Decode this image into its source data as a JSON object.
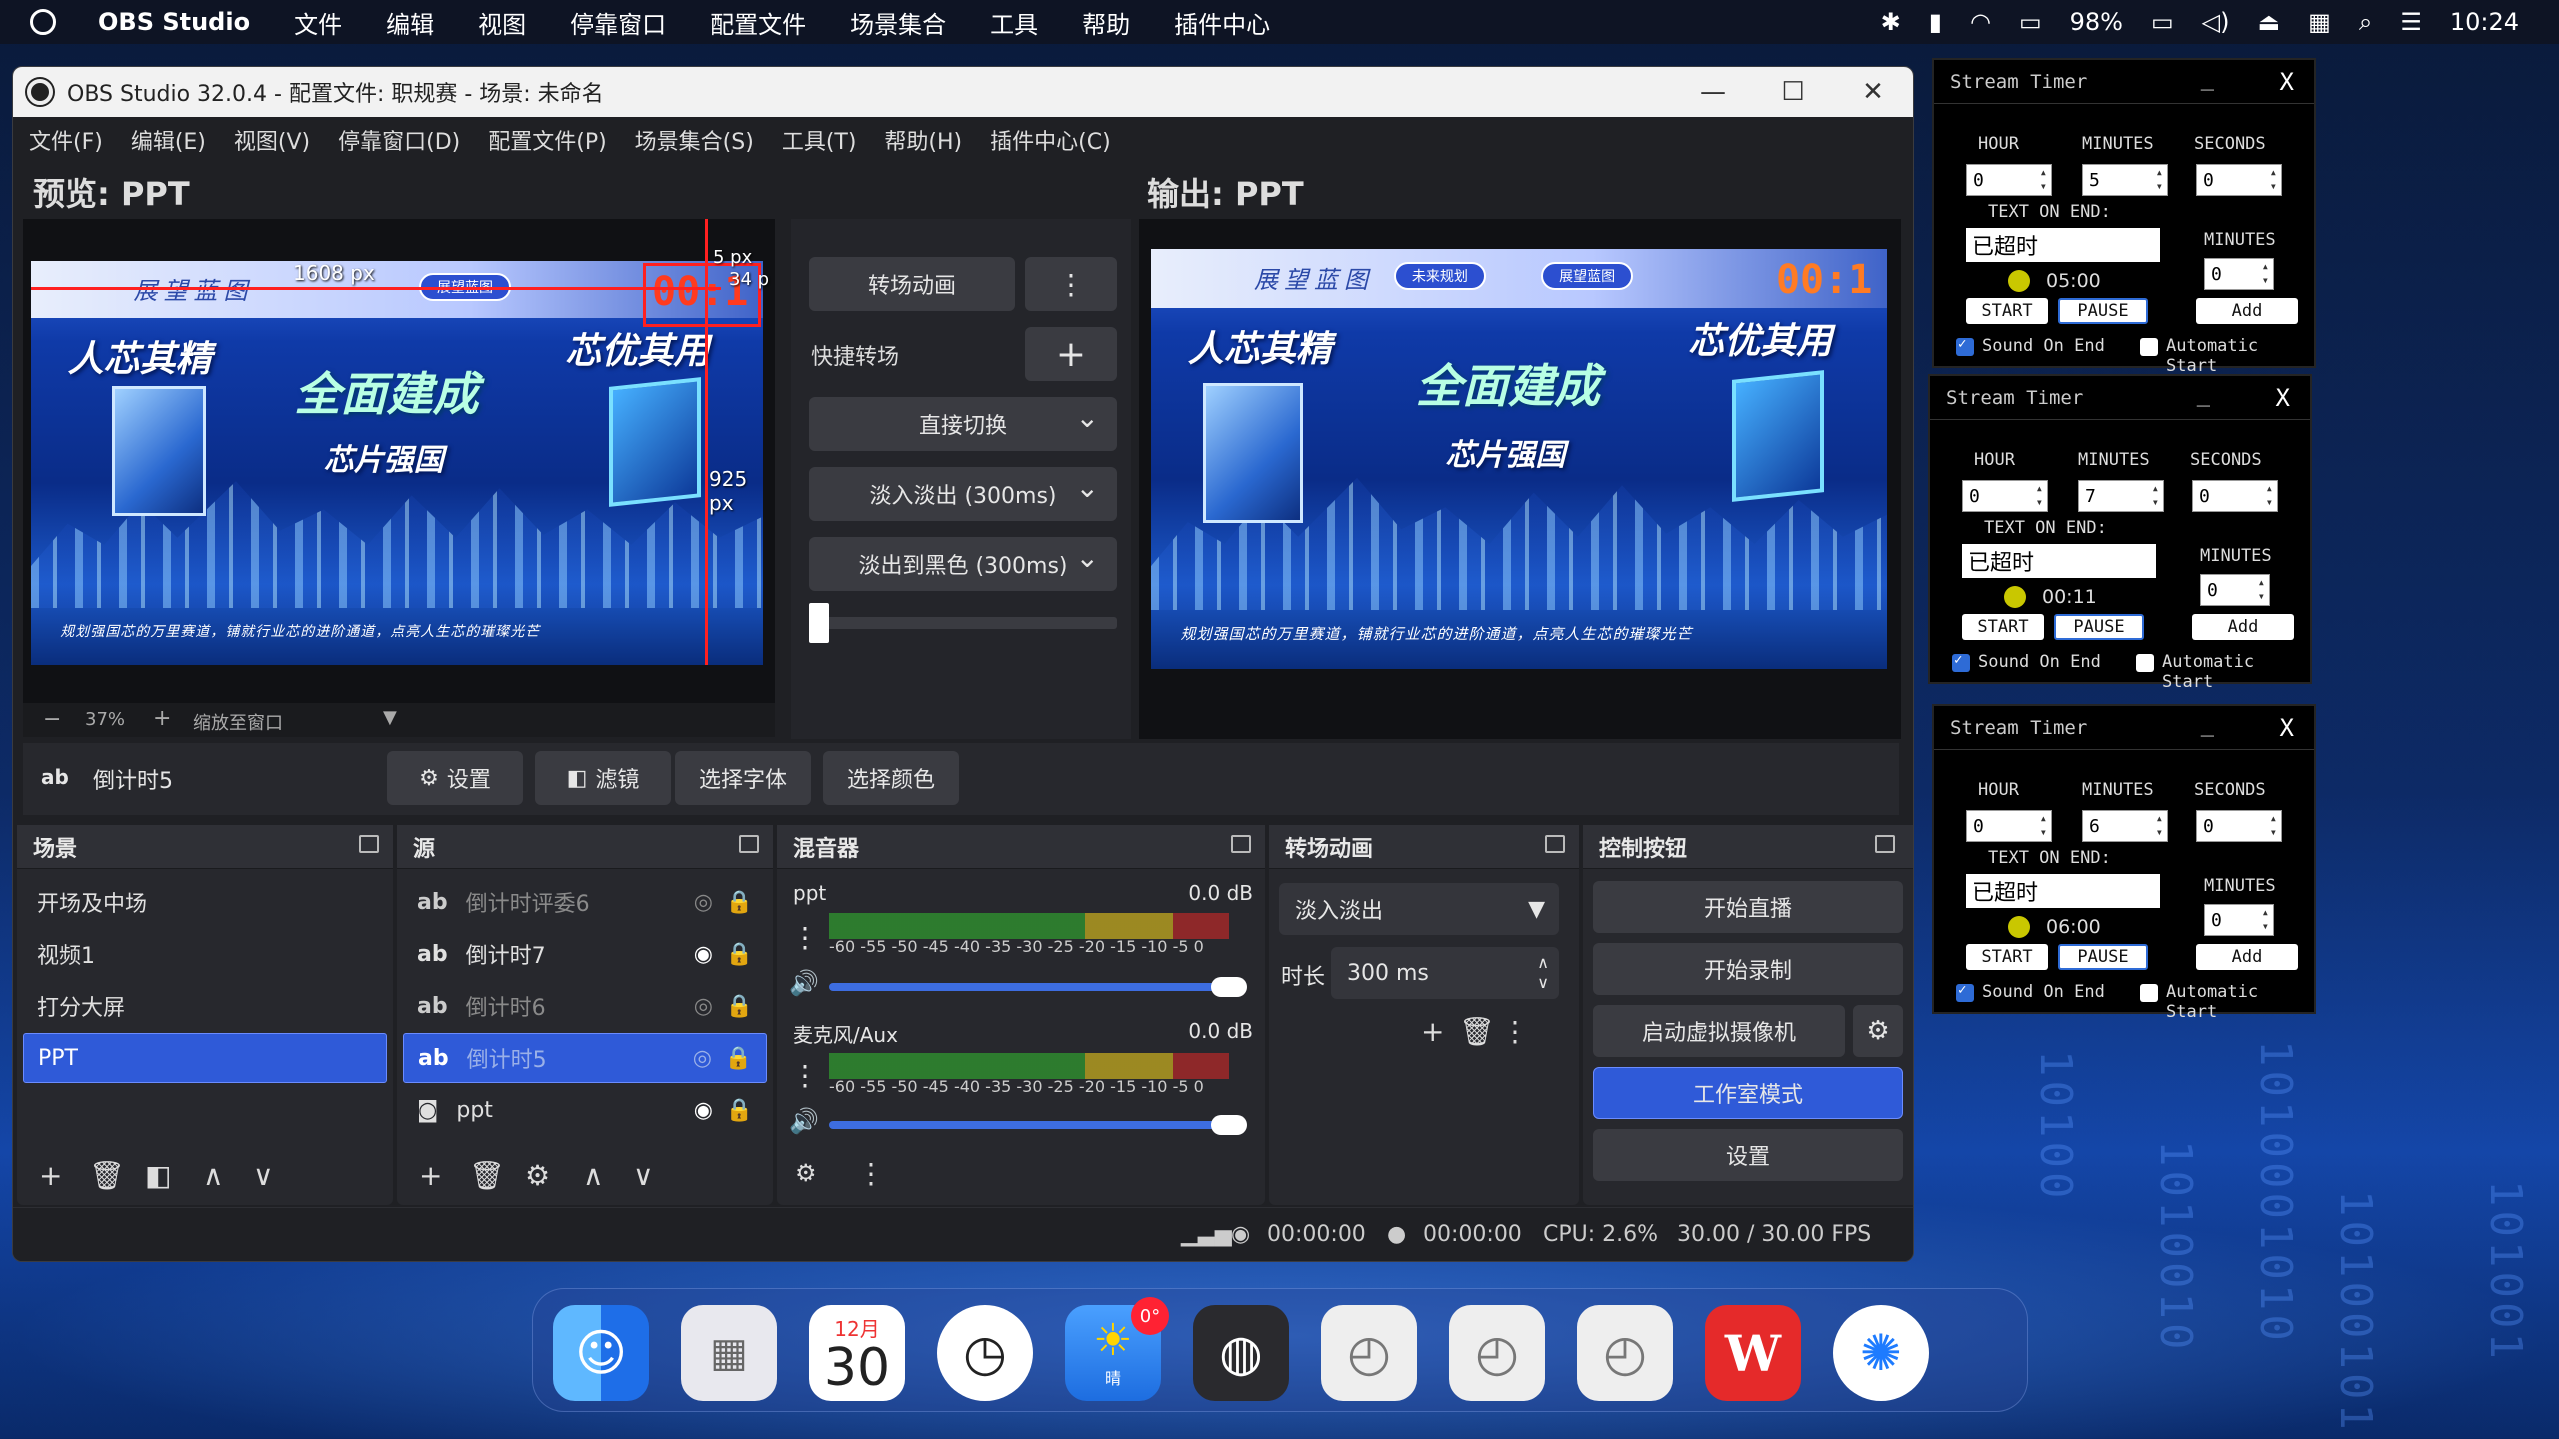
{
  "menubar": {
    "app": "OBS Studio",
    "items": [
      "文件",
      "编辑",
      "视图",
      "停靠窗口",
      "配置文件",
      "场景集合",
      "工具",
      "帮助",
      "插件中心"
    ],
    "battery": "98%",
    "time": "10:24"
  },
  "window": {
    "title": "OBS Studio 32.0.4 - 配置文件: 职规赛 - 场景: 未命名",
    "menu": [
      "文件(F)",
      "编辑(E)",
      "视图(V)",
      "停靠窗口(D)",
      "配置文件(P)",
      "场景集合(S)",
      "工具(T)",
      "帮助(H)",
      "插件中心(C)"
    ]
  },
  "preview": {
    "label": "预览:  PPT",
    "dim_width": "1608 px",
    "dim_height": "925 px",
    "dim_right": "5 px",
    "dim_right2": "34 p",
    "zoom": "37%",
    "zoom_mode": "缩放至窗口",
    "timer_text": "00:1",
    "zoom_minus": "−",
    "zoom_plus": "+"
  },
  "output": {
    "label": "输出:  PPT",
    "timer_text": "00:1"
  },
  "scene_art": {
    "brand": "展望蓝图",
    "pill": "展望蓝图",
    "pill2": "未来规划",
    "left_slogan": "人芯其精",
    "center_title": "全面建成",
    "right_slogan": "芯优其用",
    "subtitle": "芯片强国",
    "tagline": "规划强国芯的万里赛道，铺就行业芯的进阶通道，点亮人生芯的璀璨光芒"
  },
  "transitions_panel": {
    "transition_btn": "转场动画",
    "quick_label": "快捷转场",
    "cut": "直接切换",
    "fade": "淡入淡出 (300ms)",
    "fade_black": "淡出到黑色 (300ms)"
  },
  "source_toolbar": {
    "source_name": "倒计时5",
    "settings": "设置",
    "filters": "滤镜",
    "font": "选择字体",
    "color": "选择颜色"
  },
  "scenes": {
    "title": "场景",
    "items": [
      "开场及中场",
      "视频1",
      "打分大屏",
      "PPT"
    ],
    "selected": "PPT"
  },
  "sources": {
    "title": "源",
    "items": [
      {
        "name": "倒计时评委6",
        "type": "ab"
      },
      {
        "name": "倒计时7",
        "type": "ab"
      },
      {
        "name": "倒计时6",
        "type": "ab"
      },
      {
        "name": "倒计时5",
        "type": "ab"
      },
      {
        "name": "ppt",
        "type": "camera"
      }
    ]
  },
  "mixer": {
    "title": "混音器",
    "channels": [
      {
        "name": "ppt",
        "db": "0.0 dB"
      },
      {
        "name": "麦克风/Aux",
        "db": "0.0 dB"
      }
    ],
    "scale": [
      "-60",
      "-55",
      "-50",
      "-45",
      "-40",
      "-35",
      "-30",
      "-25",
      "-20",
      "-15",
      "-10",
      "-5",
      "0"
    ]
  },
  "transition_dock": {
    "title": "转场动画",
    "select": "淡入淡出",
    "duration_label": "时长",
    "duration": "300 ms"
  },
  "controls": {
    "title": "控制按钮",
    "stream": "开始直播",
    "record": "开始录制",
    "virtualcam": "启动虚拟摄像机",
    "studio": "工作室模式",
    "settings": "设置"
  },
  "status": {
    "stream_time": "00:00:00",
    "rec_time": "00:00:00",
    "cpu": "CPU: 2.6%",
    "fps": "30.00 / 30.00 FPS"
  },
  "timers": [
    {
      "title": "Stream Timer",
      "hour": "0",
      "minutes": "5",
      "seconds": "0",
      "text_on_end": "已超时",
      "countdown": "05:00",
      "add_minutes": "0"
    },
    {
      "title": "Stream Timer",
      "hour": "0",
      "minutes": "7",
      "seconds": "0",
      "text_on_end": "已超时",
      "countdown": "00:11",
      "add_minutes": "0"
    },
    {
      "title": "Stream Timer",
      "hour": "0",
      "minutes": "6",
      "seconds": "0",
      "text_on_end": "已超时",
      "countdown": "06:00",
      "add_minutes": "0"
    }
  ],
  "timer_labels": {
    "hour": "HOUR",
    "minutes": "MINUTES",
    "seconds": "SECONDS",
    "text_on_end": "TEXT ON END:",
    "minutes2": "MINUTES",
    "start": "START",
    "pause": "PAUSE",
    "add": "Add",
    "sound": "Sound On End",
    "auto": "Automatic Start",
    "minimize": "_",
    "close": "X"
  },
  "dock": {
    "calendar_month": "12月",
    "calendar_day": "30",
    "weather_badge": "0°",
    "weather_label": "晴"
  }
}
